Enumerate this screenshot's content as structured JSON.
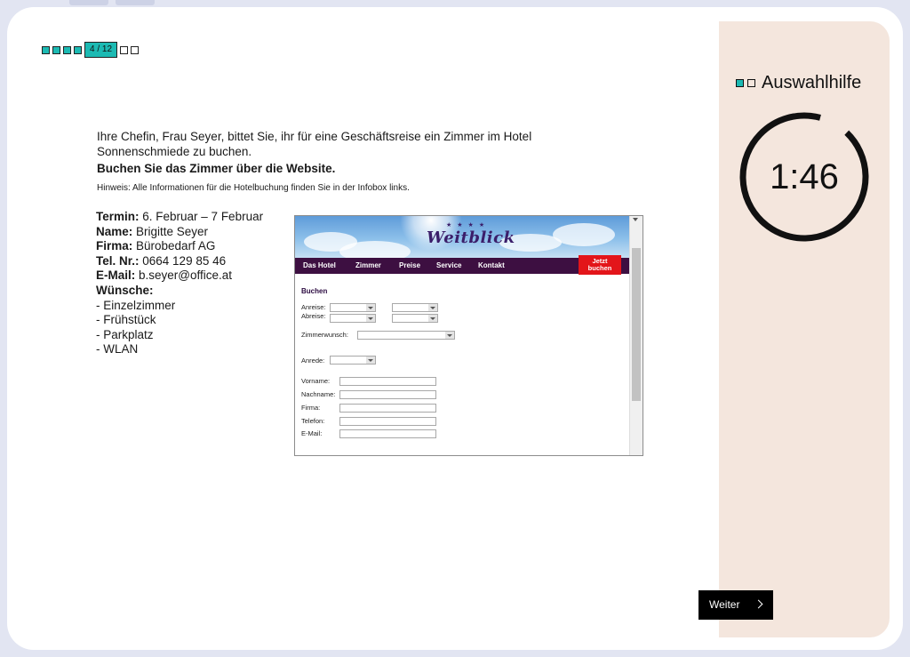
{
  "progress": {
    "completed_steps": 4,
    "total_steps": 12,
    "label": "4 / 12"
  },
  "task": {
    "intro_line1": "Ihre Chefin, Frau Seyer, bittet Sie, ihr für eine Geschäftsreise ein Zimmer im Hotel",
    "intro_line2": "Sonnenschmiede zu buchen.",
    "instruction": "Buchen Sie das Zimmer über die Website.",
    "hint": "Hinweis: Alle Informationen für die Hotelbuchung finden Sie in der Infobox links."
  },
  "infobox": {
    "termin_label": "Termin:",
    "termin_value": " 6. Februar – 7 Februar",
    "name_label": "Name:",
    "name_value": " Brigitte Seyer",
    "firma_label": "Firma:",
    "firma_value": " Bürobedarf AG",
    "tel_label": "Tel. Nr.:",
    "tel_value": " 0664 129 85 46",
    "email_label": "E-Mail:",
    "email_value": " b.seyer@office.at",
    "wuensche_label": "Wünsche:",
    "wishes": [
      "- Einzelzimmer",
      "- Frühstück",
      "- Parkplatz",
      "- WLAN"
    ]
  },
  "website": {
    "logo": "Weitblick",
    "logo_stars": "★★★★",
    "nav": [
      "Das Hotel",
      "Zimmer",
      "Preise",
      "Service",
      "Kontakt"
    ],
    "book_button": [
      "Jetzt",
      "buchen"
    ],
    "form_title": "Buchen",
    "labels": {
      "anreise": "Anreise:",
      "abreise": "Abreise:",
      "zimmerwunsch": "Zimmerwunsch:",
      "anrede": "Anrede:",
      "vorname": "Vorname:",
      "nachname": "Nachname:",
      "firma": "Firma:",
      "telefon": "Telefon:",
      "email": "E-Mail:"
    }
  },
  "helper": {
    "title": "Auswahlhilfe",
    "timer": "1:46",
    "timer_remaining_fraction": 0.92
  },
  "navigation": {
    "next_label": "Weiter"
  },
  "colors": {
    "accent": "#1cbab3",
    "panel": "#f4e6dd",
    "site_nav": "#3d0f41",
    "book_red": "#e3151a"
  }
}
